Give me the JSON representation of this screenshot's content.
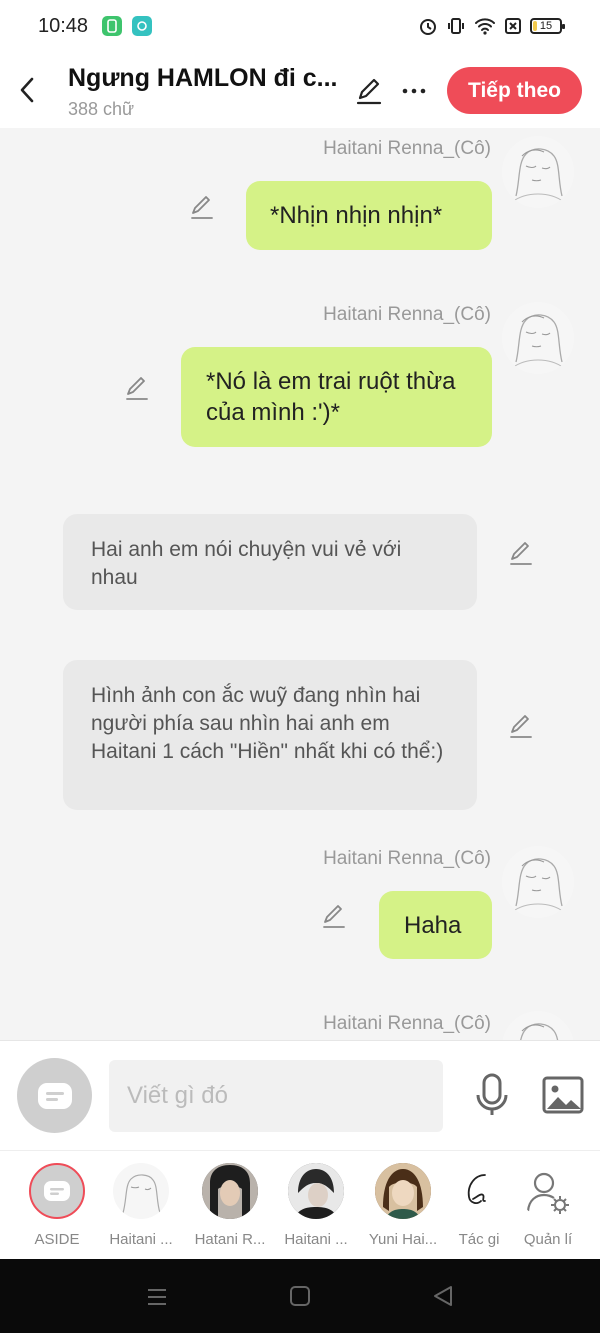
{
  "status_bar": {
    "time": "10:48",
    "battery": "15"
  },
  "header": {
    "title": "Ngưng HAMLON đi c...",
    "word_count": "388 chữ",
    "next_label": "Tiếp theo"
  },
  "messages": [
    {
      "type": "character",
      "name": "Haitani Renna_(Cô)",
      "text": "*Nhịn nhịn nhịn*"
    },
    {
      "type": "character",
      "name": "Haitani Renna_(Cô)",
      "text": "*Nó là em trai ruột thừa của mình :')*"
    },
    {
      "type": "narration",
      "text": "Hai anh em nói chuyện vui vẻ với nhau"
    },
    {
      "type": "narration",
      "text": "Hình ảnh con ắc wuỹ đang nhìn hai người phía sau nhìn hai anh em Haitani 1 cách \"Hiền\" nhất khi có thể:)"
    },
    {
      "type": "character",
      "name": "Haitani Renna_(Cô)",
      "text": "Haha"
    },
    {
      "type": "character",
      "name": "Haitani Renna_(Cô)",
      "text": ""
    }
  ],
  "input": {
    "placeholder": "Viết gì đó"
  },
  "characters": [
    {
      "label": "ASIDE",
      "icon": "aside-icon"
    },
    {
      "label": "Haitani ...",
      "icon": "sketch-girl-avatar"
    },
    {
      "label": "Hatani R...",
      "icon": "dark-hair-avatar"
    },
    {
      "label": "Haitani ...",
      "icon": "dark-hair-avatar"
    },
    {
      "label": "Yuni Hai...",
      "icon": "brown-hair-avatar"
    },
    {
      "label": "Tác gi",
      "icon": "author-icon"
    },
    {
      "label": "Quản lí",
      "icon": "manage-user-icon"
    }
  ],
  "colors": {
    "accent": "#ef4c58",
    "bubble": "#d5f287",
    "narration": "#e9e9e9"
  }
}
